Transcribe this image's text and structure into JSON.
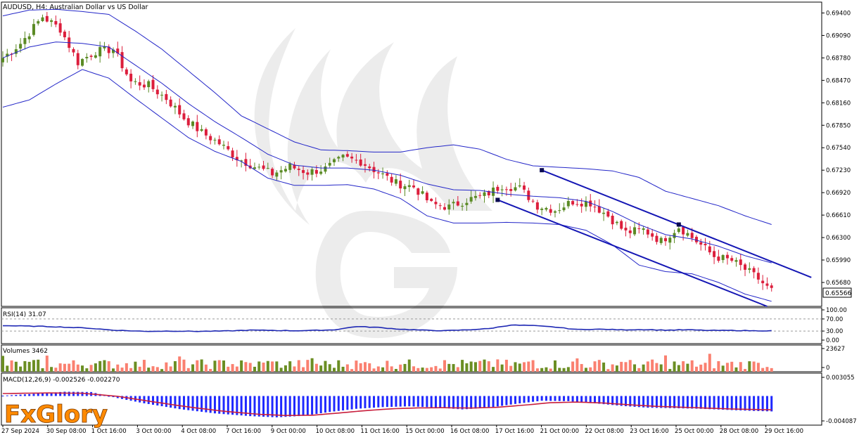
{
  "symbol_header": "AUDUSD, H4:  Australian Dollar vs US Dollar",
  "current_price": "0.65566",
  "watermark_brand": "FxGlory",
  "colors": {
    "bull": "#5a8a24",
    "bear": "#dc1e3c",
    "bands": "#2326c8",
    "channel": "#1416b4",
    "rsi": "#1e28b4",
    "macd_hist": "#1e28ff",
    "macd_signal": "#c81e3c",
    "vol_up": "#6b8e23",
    "vol_down": "#fa8070"
  },
  "chart_data": [
    {
      "type": "candlestick",
      "title": "AUDUSD, H4:  Australian Dollar vs US Dollar",
      "ylim": [
        0.6535,
        0.6955
      ],
      "y_ticks": [
        "0.69400",
        "0.69090",
        "0.68780",
        "0.68470",
        "0.68160",
        "0.67850",
        "0.67540",
        "0.67230",
        "0.66920",
        "0.66610",
        "0.66300",
        "0.65990",
        "0.65680"
      ],
      "x_ticks": [
        "27 Sep 2024",
        "30 Sep 08:00",
        "1 Oct 16:00",
        "3 Oct 00:00",
        "4 Oct 08:00",
        "7 Oct 16:00",
        "9 Oct 00:00",
        "10 Oct 08:00",
        "11 Oct 16:00",
        "15 Oct 00:00",
        "16 Oct 08:00",
        "17 Oct 16:00",
        "21 Oct 00:00",
        "22 Oct 08:00",
        "23 Oct 16:00",
        "25 Oct 00:00",
        "28 Oct 08:00",
        "29 Oct 16:00"
      ],
      "close_anchors": [
        [
          0,
          0.6878
        ],
        [
          4,
          0.6898
        ],
        [
          9,
          0.6935
        ],
        [
          13,
          0.6918
        ],
        [
          17,
          0.6872
        ],
        [
          21,
          0.6887
        ],
        [
          25,
          0.689
        ],
        [
          29,
          0.6845
        ],
        [
          33,
          0.684
        ],
        [
          37,
          0.6822
        ],
        [
          41,
          0.6795
        ],
        [
          45,
          0.6775
        ],
        [
          49,
          0.676
        ],
        [
          53,
          0.674
        ],
        [
          57,
          0.6728
        ],
        [
          61,
          0.6718
        ],
        [
          65,
          0.6728
        ],
        [
          69,
          0.672
        ],
        [
          73,
          0.6725
        ],
        [
          77,
          0.674
        ],
        [
          81,
          0.6735
        ],
        [
          85,
          0.672
        ],
        [
          89,
          0.6705
        ],
        [
          93,
          0.67
        ],
        [
          97,
          0.6676
        ],
        [
          101,
          0.6672
        ],
        [
          105,
          0.6682
        ],
        [
          109,
          0.6688
        ],
        [
          113,
          0.6702
        ],
        [
          117,
          0.6698
        ],
        [
          121,
          0.6674
        ],
        [
          125,
          0.6668
        ],
        [
          129,
          0.668
        ],
        [
          133,
          0.6678
        ],
        [
          137,
          0.666
        ],
        [
          141,
          0.6637
        ],
        [
          145,
          0.6641
        ],
        [
          149,
          0.6625
        ],
        [
          153,
          0.6645
        ],
        [
          157,
          0.6625
        ],
        [
          161,
          0.6604
        ],
        [
          165,
          0.6598
        ],
        [
          169,
          0.6582
        ],
        [
          171,
          0.6573
        ],
        [
          173,
          0.6561
        ],
        [
          174,
          0.6557
        ]
      ],
      "bollinger_upper_anchors": [
        [
          0,
          0.6936
        ],
        [
          6,
          0.6944
        ],
        [
          12,
          0.6945
        ],
        [
          18,
          0.6942
        ],
        [
          24,
          0.6938
        ],
        [
          30,
          0.6915
        ],
        [
          36,
          0.689
        ],
        [
          42,
          0.686
        ],
        [
          48,
          0.683
        ],
        [
          54,
          0.6798
        ],
        [
          60,
          0.678
        ],
        [
          66,
          0.6762
        ],
        [
          72,
          0.6751
        ],
        [
          78,
          0.675
        ],
        [
          84,
          0.6748
        ],
        [
          90,
          0.6748
        ],
        [
          96,
          0.6754
        ],
        [
          102,
          0.6758
        ],
        [
          108,
          0.6752
        ],
        [
          114,
          0.6738
        ],
        [
          120,
          0.6729
        ],
        [
          126,
          0.6727
        ],
        [
          132,
          0.6725
        ],
        [
          138,
          0.6722
        ],
        [
          144,
          0.6713
        ],
        [
          150,
          0.6694
        ],
        [
          156,
          0.6684
        ],
        [
          162,
          0.6674
        ],
        [
          168,
          0.666
        ],
        [
          172,
          0.6652
        ],
        [
          174,
          0.6648
        ]
      ],
      "bollinger_middle_anchors": [
        [
          0,
          0.6878
        ],
        [
          6,
          0.6893
        ],
        [
          12,
          0.69
        ],
        [
          18,
          0.6898
        ],
        [
          24,
          0.6893
        ],
        [
          30,
          0.6868
        ],
        [
          36,
          0.6843
        ],
        [
          42,
          0.6815
        ],
        [
          48,
          0.679
        ],
        [
          54,
          0.6768
        ],
        [
          60,
          0.6745
        ],
        [
          66,
          0.673
        ],
        [
          72,
          0.6726
        ],
        [
          78,
          0.6726
        ],
        [
          84,
          0.6723
        ],
        [
          90,
          0.6716
        ],
        [
          96,
          0.6704
        ],
        [
          102,
          0.6696
        ],
        [
          108,
          0.6695
        ],
        [
          114,
          0.669
        ],
        [
          120,
          0.6687
        ],
        [
          126,
          0.6685
        ],
        [
          132,
          0.668
        ],
        [
          138,
          0.6666
        ],
        [
          144,
          0.6648
        ],
        [
          150,
          0.6634
        ],
        [
          156,
          0.6628
        ],
        [
          162,
          0.6618
        ],
        [
          168,
          0.6605
        ],
        [
          174,
          0.6595
        ]
      ],
      "bollinger_lower_anchors": [
        [
          0,
          0.681
        ],
        [
          6,
          0.682
        ],
        [
          12,
          0.6842
        ],
        [
          18,
          0.6862
        ],
        [
          24,
          0.685
        ],
        [
          30,
          0.6822
        ],
        [
          36,
          0.6795
        ],
        [
          42,
          0.6768
        ],
        [
          48,
          0.6749
        ],
        [
          54,
          0.6735
        ],
        [
          60,
          0.6712
        ],
        [
          66,
          0.6702
        ],
        [
          72,
          0.6702
        ],
        [
          78,
          0.6703
        ],
        [
          84,
          0.6697
        ],
        [
          90,
          0.6684
        ],
        [
          96,
          0.666
        ],
        [
          102,
          0.665
        ],
        [
          108,
          0.665
        ],
        [
          114,
          0.6651
        ],
        [
          120,
          0.665
        ],
        [
          126,
          0.6648
        ],
        [
          132,
          0.664
        ],
        [
          138,
          0.662
        ],
        [
          144,
          0.6592
        ],
        [
          150,
          0.6583
        ],
        [
          156,
          0.658
        ],
        [
          162,
          0.6568
        ],
        [
          168,
          0.6552
        ],
        [
          174,
          0.6542
        ]
      ],
      "channel_upper": [
        [
          122,
          0.6723
        ],
        [
          183,
          0.6575
        ]
      ],
      "channel_lower": [
        [
          112,
          0.6682
        ],
        [
          173,
          0.6535
        ]
      ],
      "channel_markers": [
        [
          122,
          0.6723
        ],
        [
          112,
          0.6682
        ],
        [
          153,
          0.6648
        ]
      ]
    },
    {
      "type": "line",
      "title": "RSI(14) 31.07",
      "ylim": [
        0,
        100
      ],
      "y_ticks": [
        "100.00",
        "70.00",
        "30.00",
        "0.00"
      ],
      "levels": [
        70,
        30
      ],
      "anchors": [
        [
          0,
          48
        ],
        [
          10,
          45
        ],
        [
          19,
          40
        ],
        [
          25,
          33
        ],
        [
          32,
          29
        ],
        [
          38,
          30
        ],
        [
          44,
          29
        ],
        [
          50,
          30
        ],
        [
          56,
          33
        ],
        [
          62,
          32
        ],
        [
          66,
          31
        ],
        [
          70,
          32
        ],
        [
          75,
          34
        ],
        [
          80,
          45
        ],
        [
          85,
          42
        ],
        [
          90,
          36
        ],
        [
          95,
          33
        ],
        [
          100,
          31
        ],
        [
          105,
          34
        ],
        [
          110,
          38
        ],
        [
          115,
          50
        ],
        [
          120,
          48
        ],
        [
          125,
          43
        ],
        [
          130,
          35
        ],
        [
          135,
          36
        ],
        [
          140,
          34
        ],
        [
          145,
          35
        ],
        [
          150,
          33
        ],
        [
          155,
          34
        ],
        [
          160,
          32
        ],
        [
          165,
          32
        ],
        [
          170,
          31
        ],
        [
          174,
          31.07
        ]
      ]
    },
    {
      "type": "bar",
      "title": "Volumes 3462",
      "ylim": [
        0,
        23627
      ],
      "y_ticks": [
        "23627",
        "0"
      ],
      "last_value": 3462
    },
    {
      "type": "bar",
      "title": "MACD(12,26,9) -0.002526 -0.002270",
      "ylim": [
        -0.004087,
        0.003055
      ],
      "y_ticks": [
        "0.003055",
        "-0.004087"
      ],
      "macd_anchors": [
        [
          0,
          5e-05
        ],
        [
          8,
          0.0004
        ],
        [
          14,
          0.0007
        ],
        [
          20,
          0.00065
        ],
        [
          26,
          -0.00035
        ],
        [
          32,
          -0.0012
        ],
        [
          40,
          -0.00215
        ],
        [
          48,
          -0.00285
        ],
        [
          56,
          -0.0033
        ],
        [
          62,
          -0.0035
        ],
        [
          68,
          -0.00325
        ],
        [
          74,
          -0.00262
        ],
        [
          80,
          -0.0021
        ],
        [
          86,
          -0.00182
        ],
        [
          92,
          -0.0017
        ],
        [
          98,
          -0.00188
        ],
        [
          104,
          -0.0022
        ],
        [
          110,
          -0.00192
        ],
        [
          116,
          -0.0013
        ],
        [
          122,
          -0.00078
        ],
        [
          128,
          -0.00085
        ],
        [
          134,
          -0.0012
        ],
        [
          140,
          -0.00162
        ],
        [
          146,
          -0.00192
        ],
        [
          152,
          -0.002
        ],
        [
          158,
          -0.0021
        ],
        [
          164,
          -0.00228
        ],
        [
          170,
          -0.00245
        ],
        [
          174,
          -0.002526
        ]
      ],
      "signal_anchors": [
        [
          0,
          0.0004
        ],
        [
          10,
          0.0005
        ],
        [
          18,
          0.00045
        ],
        [
          26,
          -5e-05
        ],
        [
          34,
          -0.00095
        ],
        [
          42,
          -0.0018
        ],
        [
          50,
          -0.0025
        ],
        [
          58,
          -0.003
        ],
        [
          64,
          -0.0032
        ],
        [
          70,
          -0.00315
        ],
        [
          76,
          -0.0028
        ],
        [
          82,
          -0.0024
        ],
        [
          88,
          -0.0021
        ],
        [
          94,
          -0.00195
        ],
        [
          100,
          -0.00192
        ],
        [
          106,
          -0.00198
        ],
        [
          112,
          -0.00185
        ],
        [
          118,
          -0.0015
        ],
        [
          124,
          -0.0011
        ],
        [
          130,
          -0.001
        ],
        [
          136,
          -0.00115
        ],
        [
          142,
          -0.00145
        ],
        [
          148,
          -0.0017
        ],
        [
          154,
          -0.00185
        ],
        [
          160,
          -0.002
        ],
        [
          166,
          -0.00215
        ],
        [
          174,
          -0.00227
        ]
      ]
    }
  ]
}
